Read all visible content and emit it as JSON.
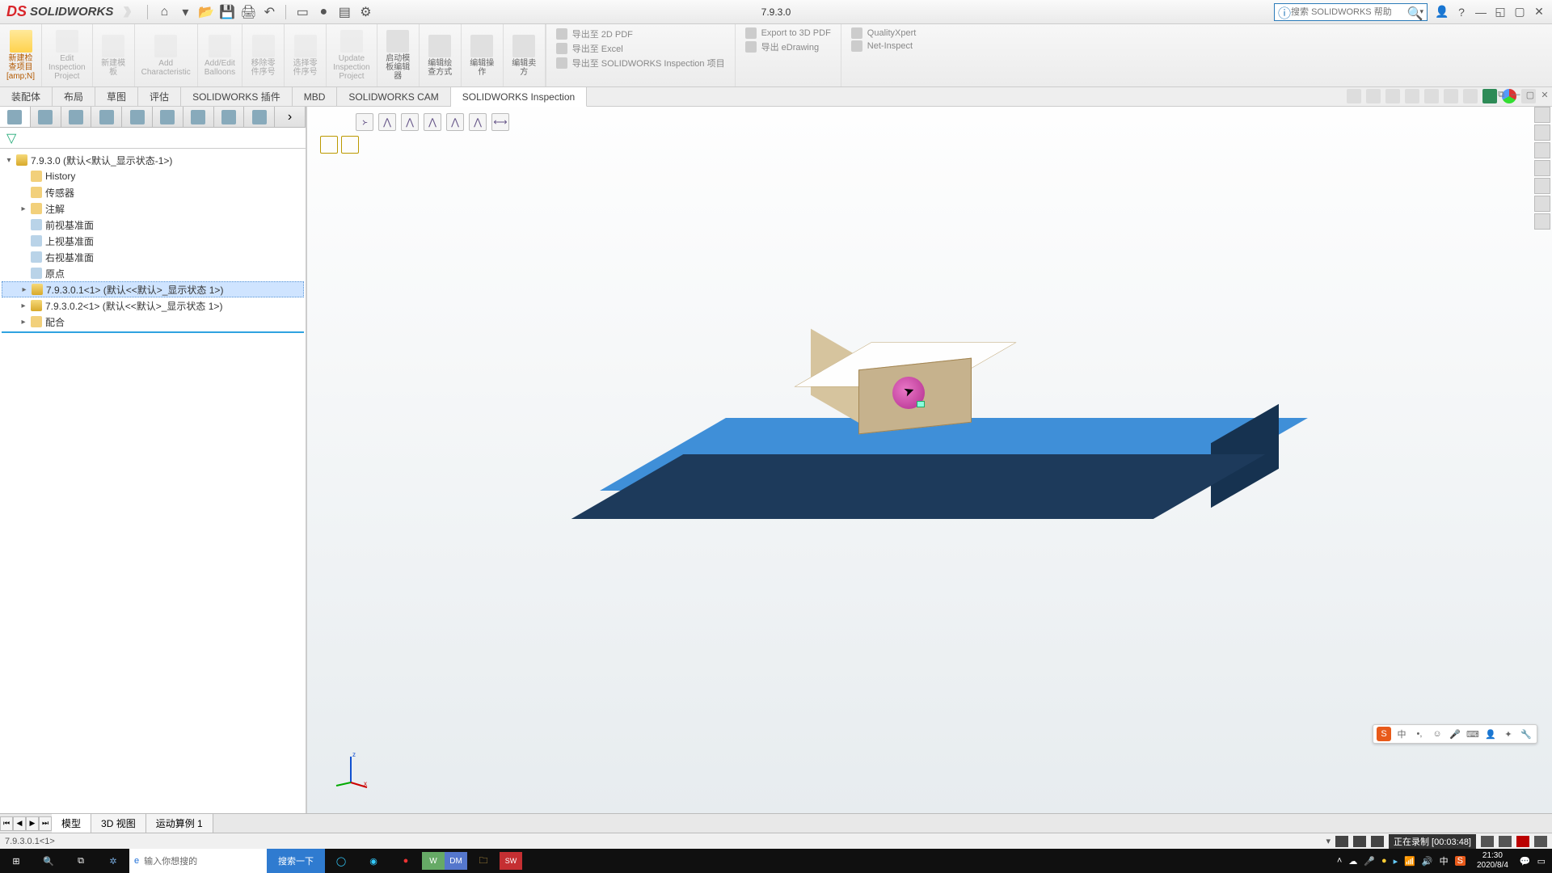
{
  "app": {
    "brand": "SOLIDWORKS",
    "doc_title": "7.9.3.0"
  },
  "search": {
    "placeholder": "搜索 SOLIDWORKS 帮助"
  },
  "ribbon": [
    {
      "label": "新建检\n查项目\n[amp;N]",
      "active": true
    },
    {
      "label": "Edit\nInspection\nProject",
      "disabled": true
    },
    {
      "label": "新建模\n板",
      "disabled": true
    },
    {
      "label": "Add\nCharacteristic",
      "disabled": true
    },
    {
      "label": "Add/Edit\nBalloons",
      "disabled": true
    },
    {
      "label": "移除零\n件序号",
      "disabled": true
    },
    {
      "label": "选择零\n件序号",
      "disabled": true
    },
    {
      "label": "Update\nInspection\nProject",
      "disabled": true
    },
    {
      "label": "启动模\n板编辑\n器"
    },
    {
      "label": "编辑绘\n查方式"
    },
    {
      "label": "编辑操\n作"
    },
    {
      "label": "编辑卖\n方"
    }
  ],
  "ribbon_right_a": [
    {
      "label": "导出至 2D PDF"
    },
    {
      "label": "导出至 Excel"
    },
    {
      "label": "导出至 SOLIDWORKS Inspection 项目"
    }
  ],
  "ribbon_right_b": [
    {
      "label": "Export to 3D PDF"
    },
    {
      "label": "导出 eDrawing"
    }
  ],
  "ribbon_right_c": [
    {
      "label": "QualityXpert"
    },
    {
      "label": "Net-Inspect"
    }
  ],
  "tabs": [
    "装配体",
    "布局",
    "草图",
    "评估",
    "SOLIDWORKS 插件",
    "MBD",
    "SOLIDWORKS CAM",
    "SOLIDWORKS Inspection"
  ],
  "tree": {
    "root": "7.9.3.0  (默认<默认_显示状态-1>)",
    "items": [
      {
        "label": "History",
        "ico": "folder"
      },
      {
        "label": "传感器",
        "ico": "folder"
      },
      {
        "label": "注解",
        "ico": "folder",
        "exp": "▸"
      },
      {
        "label": "前视基准面",
        "ico": "plane"
      },
      {
        "label": "上视基准面",
        "ico": "plane"
      },
      {
        "label": "右视基准面",
        "ico": "plane"
      },
      {
        "label": "原点",
        "ico": "plane"
      },
      {
        "label": "7.9.3.0.1<1>  (默认<<默认>_显示状态 1>)",
        "ico": "part",
        "exp": "▸",
        "selected": true
      },
      {
        "label": "7.9.3.0.2<1>  (默认<<默认>_显示状态 1>)",
        "ico": "part",
        "exp": "▸"
      },
      {
        "label": "配合",
        "ico": "folder",
        "exp": "▸"
      }
    ]
  },
  "bottom_tabs": [
    "模型",
    "3D 视图",
    "运动算例 1"
  ],
  "status": {
    "left": "7.9.3.0.1<1>",
    "rec": "正在录制 [00:03:48]"
  },
  "taskbar": {
    "search_placeholder": "输入你想搜的",
    "search_btn": "搜索一下",
    "time": "21:30",
    "date": "2020/8/4"
  }
}
